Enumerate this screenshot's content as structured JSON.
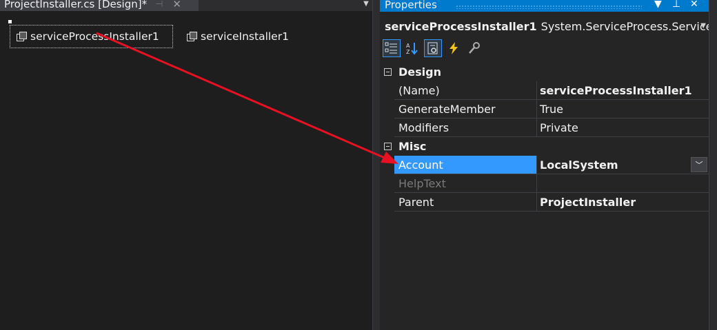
{
  "designer": {
    "tab_title": "ProjectInstaller.cs [Design]*",
    "pin_icon": "pin-icon",
    "close_icon": "close-icon",
    "components": [
      {
        "label": "serviceProcessInstaller1"
      },
      {
        "label": "serviceInstaller1"
      }
    ]
  },
  "properties": {
    "title": "Properties",
    "object_name": "serviceProcessInstaller1",
    "object_type": "System.ServiceProcess.ServiceProcessInstaller",
    "toolbar": [
      "categorized-icon",
      "alphabetical-icon",
      "properties-icon",
      "events-icon",
      "property-pages-icon"
    ],
    "categories": [
      {
        "name": "Design",
        "rows": [
          {
            "name": "(Name)",
            "value": "serviceProcessInstaller1",
            "bold": true
          },
          {
            "name": "GenerateMember",
            "value": "True"
          },
          {
            "name": "Modifiers",
            "value": "Private"
          }
        ]
      },
      {
        "name": "Misc",
        "rows": [
          {
            "name": "Account",
            "value": "LocalSystem",
            "bold": true,
            "selected": true
          },
          {
            "name": "HelpText",
            "value": "",
            "disabled": true
          },
          {
            "name": "Parent",
            "value": "ProjectInstaller",
            "bold": true
          }
        ]
      }
    ]
  },
  "colors": {
    "accent": "#007acc",
    "selection": "#3399ff",
    "annotation_arrow": "#e81123"
  }
}
